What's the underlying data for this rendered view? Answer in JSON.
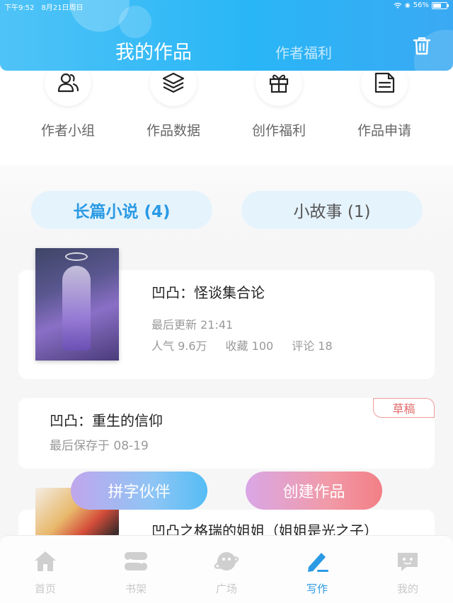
{
  "status_bar": {
    "time": "下午9:52",
    "date": "8月21日周日",
    "battery": "56%"
  },
  "header": {
    "tab_active": "我的作品",
    "tab_inactive": "作者福利",
    "trash_icon": "trash-icon",
    "accent_color": "#29b6f6"
  },
  "quick_actions": [
    {
      "label": "作者小组",
      "icon": "users-icon"
    },
    {
      "label": "作品数据",
      "icon": "layers-icon"
    },
    {
      "label": "创作福利",
      "icon": "gift-icon"
    },
    {
      "label": "作品申请",
      "icon": "document-icon"
    }
  ],
  "segment": {
    "long_novel": "长篇小说 (4)",
    "short_story": "小故事 (1)"
  },
  "works": [
    {
      "title": "凹凸：怪谈集合论",
      "last_update": "最后更新 21:41",
      "popularity": "人气 9.6万",
      "favorites": "收藏 100",
      "comments": "评论 18"
    },
    {
      "title": "凹凸：重生的信仰",
      "saved": "最后保存于 08-19",
      "badge": "草稿"
    },
    {
      "title": "凹凸之格瑞的姐姐（姐姐是光之子）"
    }
  ],
  "floating_buttons": {
    "partner": "拼字伙伴",
    "create": "创建作品"
  },
  "bottom_nav": [
    {
      "label": "首页",
      "icon": "home-icon",
      "active": false
    },
    {
      "label": "书架",
      "icon": "bookshelf-icon",
      "active": false
    },
    {
      "label": "广场",
      "icon": "planet-icon",
      "active": false
    },
    {
      "label": "写作",
      "icon": "pen-icon",
      "active": true
    },
    {
      "label": "我的",
      "icon": "chat-bubble-icon",
      "active": false
    }
  ]
}
